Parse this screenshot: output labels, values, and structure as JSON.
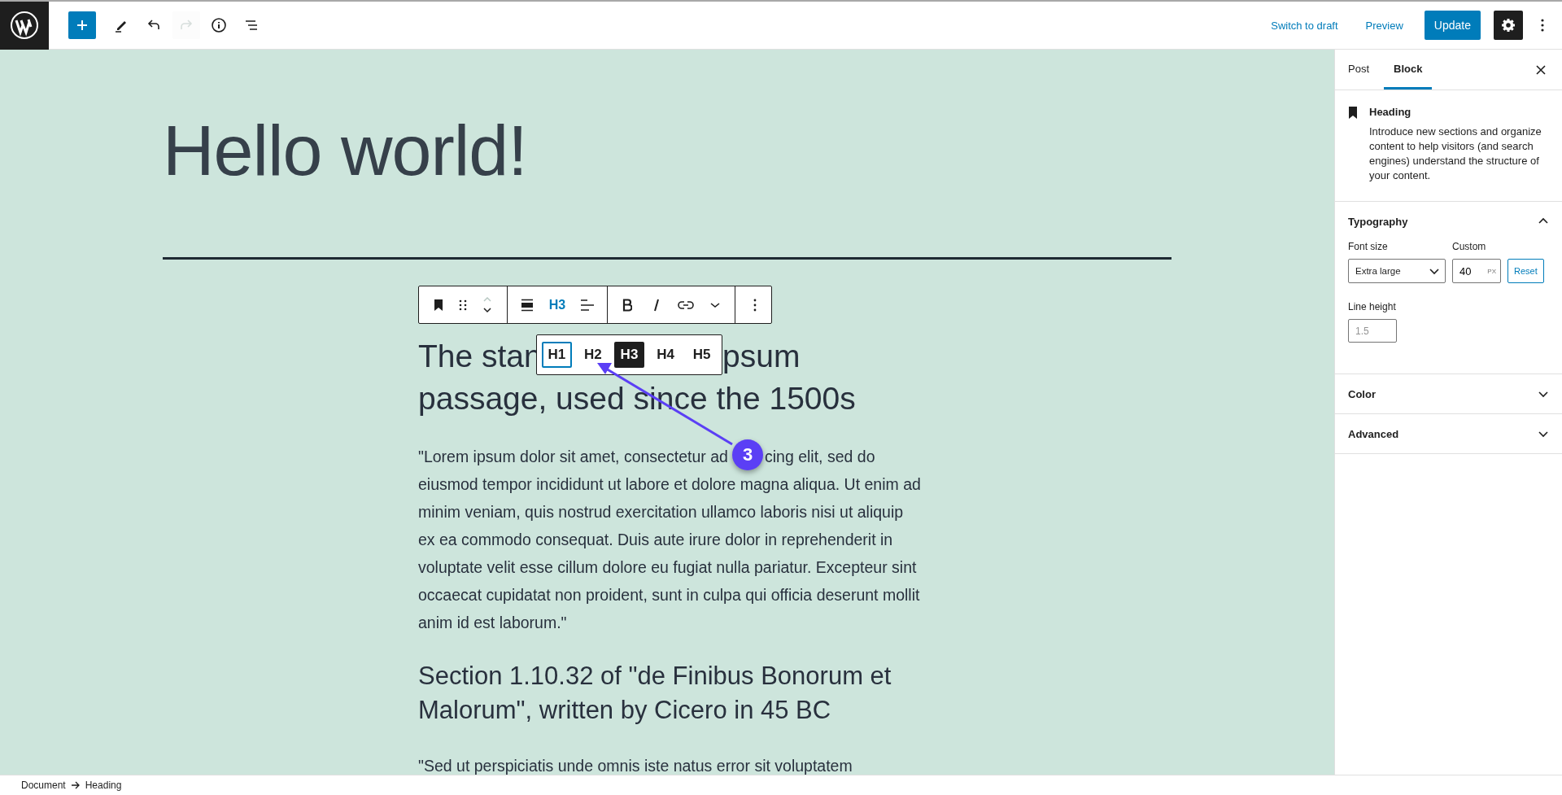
{
  "top_bar": {
    "history": [
      {
        "kind": "undo",
        "disabled": false
      },
      {
        "kind": "redo",
        "disabled": true
      }
    ],
    "switch_to_draft": "Switch to draft",
    "preview": "Preview",
    "update": "Update",
    "settings_open": true
  },
  "editor": {
    "title": "Hello world!",
    "block_toolbar": {
      "level_label": "H3"
    },
    "level_menu": [
      {
        "label": "H1",
        "selected": false,
        "focused": true
      },
      {
        "label": "H2",
        "selected": false,
        "focused": false
      },
      {
        "label": "H3",
        "selected": true,
        "focused": false
      },
      {
        "label": "H4",
        "selected": false,
        "focused": false
      },
      {
        "label": "H5",
        "selected": false,
        "focused": false
      }
    ],
    "annotation": {
      "number": "3"
    },
    "blocks": [
      {
        "kind": "covered_heading",
        "line_1_start": "The stan",
        "line_1_end": "psum",
        "line_2": "passage, used since the 1500s"
      },
      {
        "kind": "covered_paragraph",
        "line_1_start": "\"Lorem ipsum dolor sit amet, consectetur ad",
        "line_1_end": "cing elit, sed do",
        "rest": "eiusmod tempor incididunt ut labore et dolore magna aliqua. Ut enim ad minim veniam, quis nostrud exercitation ullamco laboris nisi ut aliquip ex ea commodo consequat. Duis aute irure dolor in reprehenderit in voluptate velit esse cillum dolore eu fugiat nulla pariatur. Excepteur sint occaecat cupidatat non proident, sunt in culpa qui officia deserunt mollit anim id est laborum.\""
      },
      {
        "kind": "heading",
        "text": "Section 1.10.32 of \"de Finibus Bonorum et Malorum\", written by Cicero in 45 BC"
      },
      {
        "kind": "cut_paragraph",
        "text": "\"Sed ut perspiciatis unde omnis iste natus error sit voluptatem"
      }
    ]
  },
  "sidebar": {
    "tabs": [
      {
        "label": "Post",
        "selected": false
      },
      {
        "label": "Block",
        "selected": true
      }
    ],
    "block_card": {
      "title": "Heading",
      "description": "Introduce new sections and organize content to help visitors (and search engines) understand the structure of your content."
    },
    "panels": [
      {
        "kind": "typography",
        "title": "Typography",
        "expanded": true,
        "font_size_label": "Font size",
        "font_size_value": "Extra large",
        "custom_label": "Custom",
        "custom_value": "40",
        "unit": "PX",
        "reset": "Reset",
        "line_height_label": "Line height",
        "line_height_placeholder": "1.5"
      },
      {
        "kind": "plain",
        "title": "Color",
        "expanded": false
      },
      {
        "kind": "plain",
        "title": "Advanced",
        "expanded": false
      }
    ]
  },
  "breadcrumbs": [
    "Document",
    "Heading"
  ]
}
